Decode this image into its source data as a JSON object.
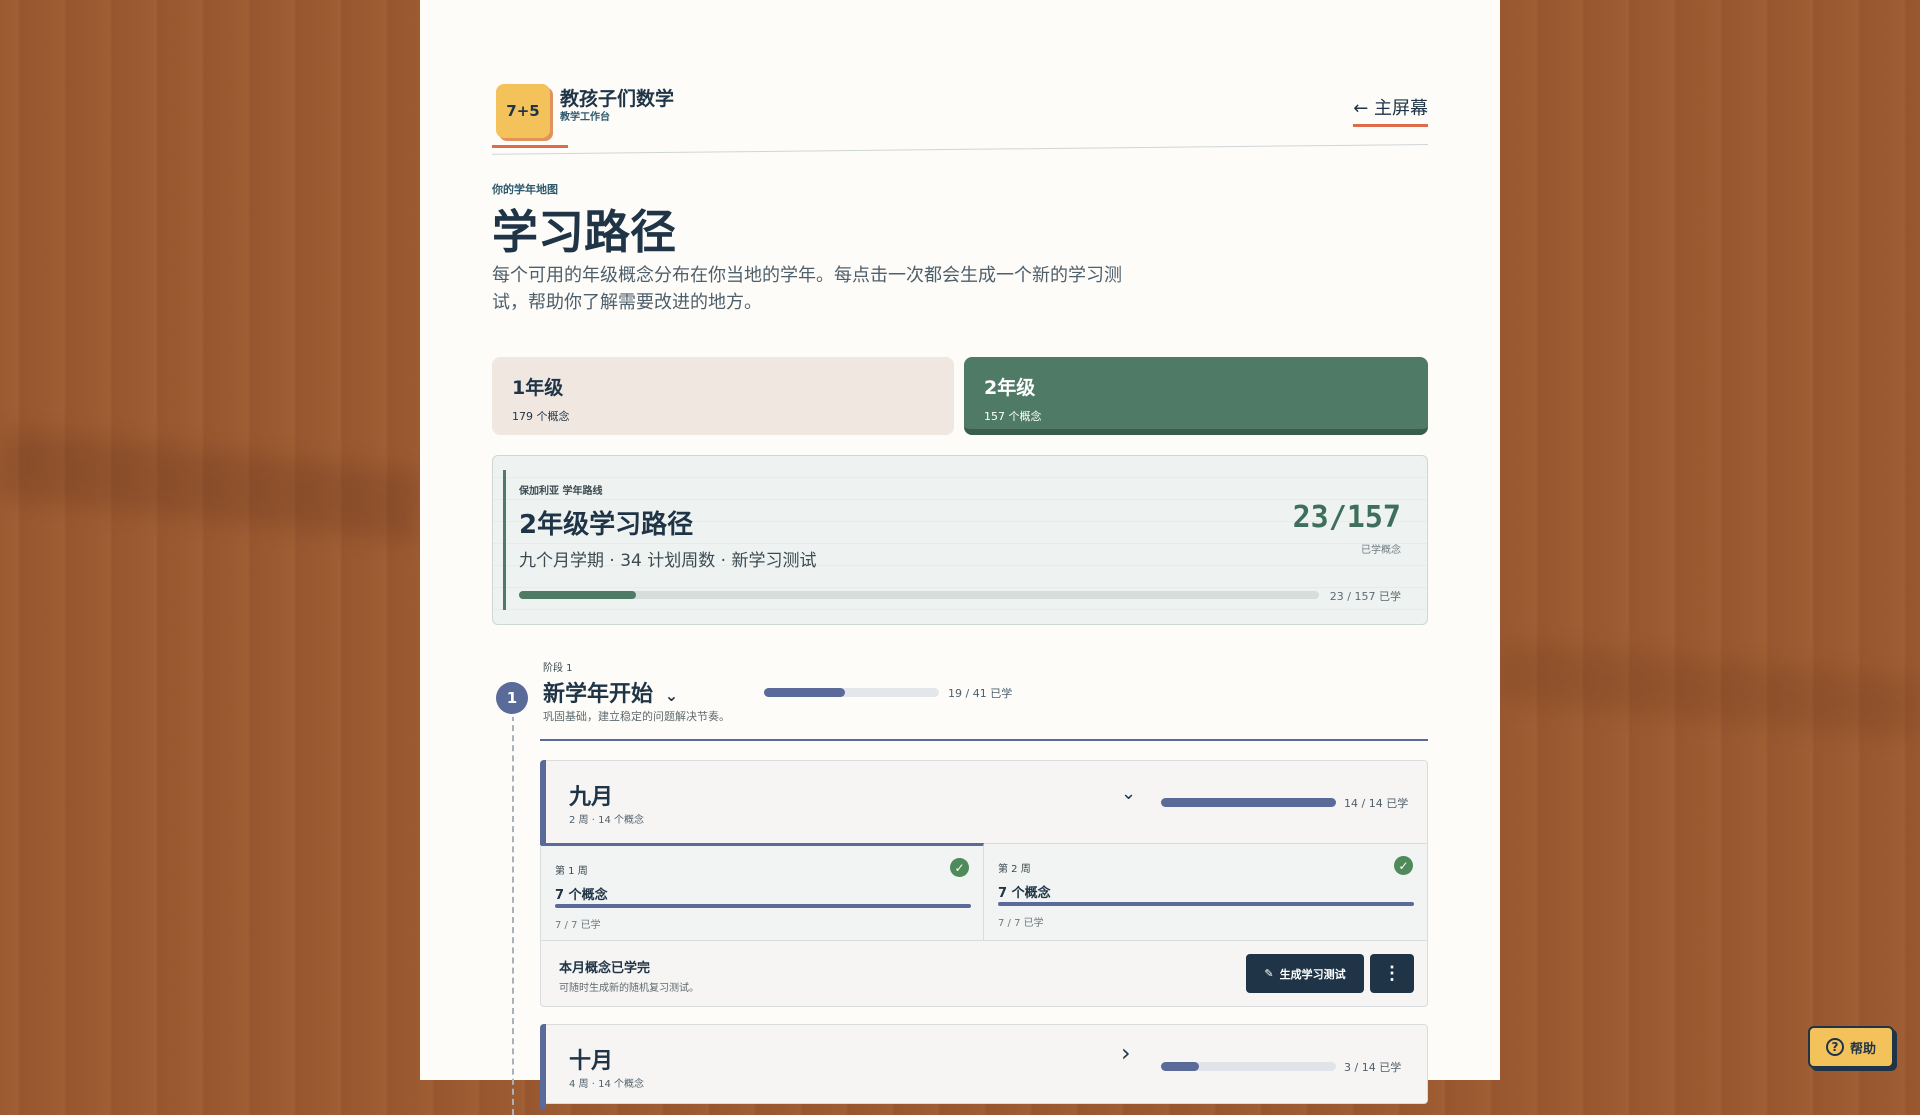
{
  "brand": {
    "logo_text": "7+5",
    "title": "教孩子们数学",
    "subtitle": "教学工作台"
  },
  "nav": {
    "home_link": "← 主屏幕"
  },
  "intro": {
    "eyebrow": "你的学年地图",
    "title": "学习路径",
    "description": "每个可用的年级概念分布在你当地的学年。每点击一次都会生成一个新的学习测试，帮助你了解需要改进的地方。"
  },
  "grades": [
    {
      "label": "1年级",
      "count": "179 个概念",
      "selected": false
    },
    {
      "label": "2年级",
      "count": "157 个概念",
      "selected": true
    }
  ],
  "path": {
    "eyebrow": "保加利亚 学年路线",
    "title": "2年级学习路径",
    "meta": "九个月学期 · 34 计划周数 · 新学习测试",
    "count": "23/157",
    "count_label": "已学概念",
    "progress_text": "23 / 157 已学",
    "progress": 0.1465
  },
  "phase": {
    "number": "1",
    "eyebrow": "阶段 1",
    "title": "新学年开始",
    "description": "巩固基础，建立稳定的问题解决节奏。",
    "progress_text": "19 / 41 已学",
    "progress": 0.4634
  },
  "months": [
    {
      "title": "九月",
      "meta": "2 周 · 14 个概念",
      "chevron": "⌄",
      "progress_text": "14 / 14 已学",
      "progress": 1.0,
      "weeks": [
        {
          "label": "第 1 周",
          "title": "7 个概念",
          "progress_text": "7 / 7 已学",
          "done": "✓"
        },
        {
          "label": "第 2 周",
          "title": "7 个概念",
          "progress_text": "7 / 7 已学",
          "done": "✓"
        }
      ],
      "footer": {
        "title": "本月概念已学完",
        "description": "可随时生成新的随机复习测试。",
        "generate_label": "生成学习测试",
        "more_label": "⋮"
      }
    },
    {
      "title": "十月",
      "meta": "4 周 · 14 个概念",
      "chevron": "›",
      "progress_text": "3 / 14 已学",
      "progress": 0.2143
    }
  ],
  "help": {
    "label": "帮助",
    "icon": "?"
  },
  "colors": {
    "accent_green": "#4f7a66",
    "accent_blue": "#5a6a99",
    "navy": "#1f3446",
    "coral": "#e06b4a",
    "logo_yellow": "#f3c25b"
  }
}
